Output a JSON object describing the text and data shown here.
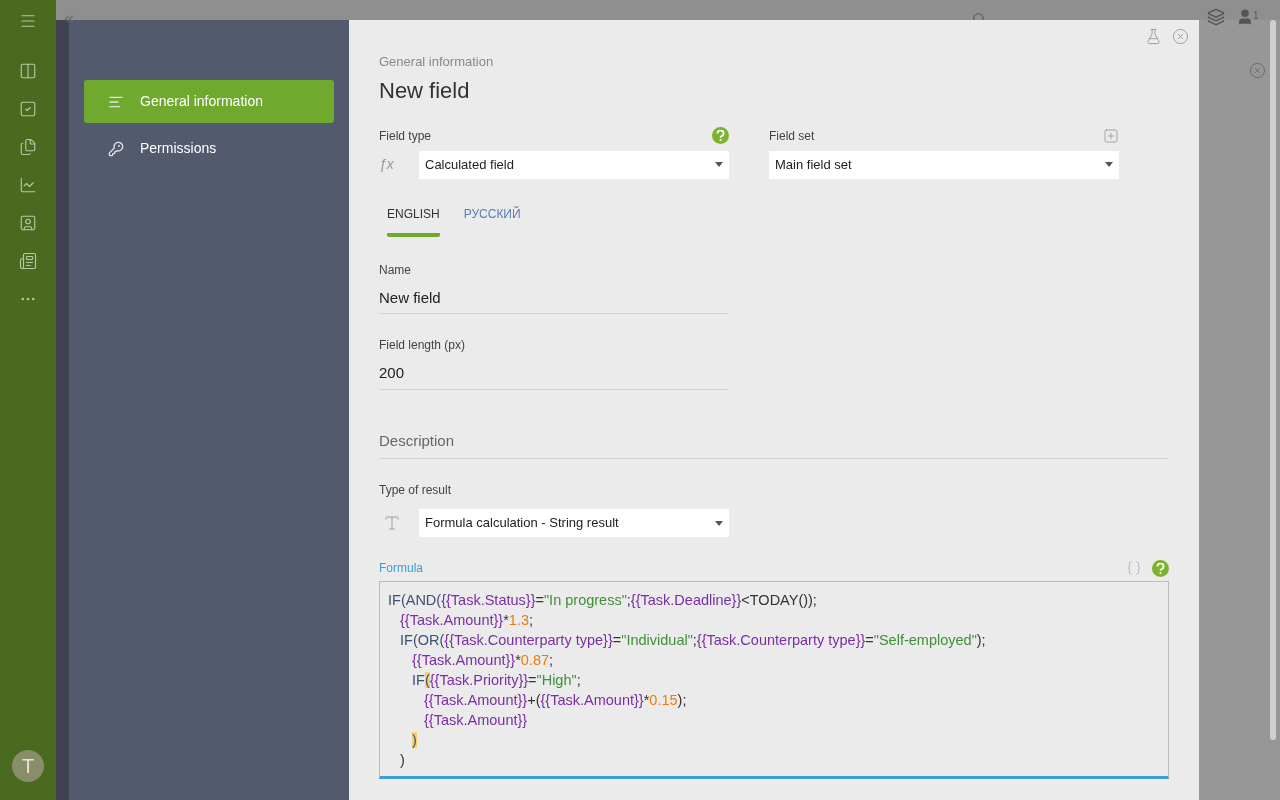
{
  "app_sidebar": {
    "items": [
      {
        "kind": "menu"
      },
      {
        "kind": "kanban"
      },
      {
        "kind": "tasks"
      },
      {
        "kind": "files"
      },
      {
        "kind": "reports"
      },
      {
        "kind": "contacts"
      },
      {
        "kind": "docs"
      },
      {
        "kind": "more"
      }
    ],
    "avatar": "T"
  },
  "top_bar": {
    "notification_count": "1"
  },
  "nav": [
    {
      "label": "General information",
      "selected": true,
      "kind": "general"
    },
    {
      "label": "Permissions",
      "selected": false,
      "kind": "permissions"
    }
  ],
  "header": {
    "breadcrumb": "General information",
    "title": "New field"
  },
  "field_type": {
    "label": "Field type",
    "symbol": "ƒx",
    "value": "Calculated field"
  },
  "field_set": {
    "label": "Field set",
    "value": "Main field set"
  },
  "language_tabs": [
    {
      "label": "ENGLISH",
      "selected": true
    },
    {
      "label": "РУССКИЙ",
      "selected": false
    }
  ],
  "name": {
    "label": "Name",
    "value": "New field"
  },
  "field_length": {
    "label": "Field length (px)",
    "value": "200"
  },
  "description": {
    "label": "Description"
  },
  "result_type": {
    "label": "Type of result",
    "value": "Formula calculation - String result"
  },
  "formula": {
    "label": "Formula",
    "lines": [
      {
        "tokens": [
          {
            "text": "IF(AND(",
            "kind": "keyword"
          },
          {
            "text": "{{Task.Status}}",
            "kind": "variable"
          },
          {
            "text": "=",
            "kind": "plain"
          },
          {
            "text": "\"In progress\"",
            "kind": "string"
          },
          {
            "text": ";",
            "kind": "plain"
          },
          {
            "text": "{{Task.Deadline}}",
            "kind": "variable"
          },
          {
            "text": "<TODAY());",
            "kind": "plain"
          }
        ],
        "children": [
          {
            "tokens": [
              {
                "text": "{{Task.Amount}}",
                "kind": "variable"
              },
              {
                "text": "*",
                "kind": "plain"
              },
              {
                "text": "1.3",
                "kind": "number"
              },
              {
                "text": ";",
                "kind": "plain"
              }
            ]
          },
          {
            "tokens": [
              {
                "text": "IF(OR(",
                "kind": "keyword"
              },
              {
                "text": "{{Task.Counterparty type}}",
                "kind": "variable"
              },
              {
                "text": "=",
                "kind": "plain"
              },
              {
                "text": "\"Individual\"",
                "kind": "string"
              },
              {
                "text": ";",
                "kind": "plain"
              },
              {
                "text": "{{Task.Counterparty type}}",
                "kind": "variable"
              },
              {
                "text": "=",
                "kind": "plain"
              },
              {
                "text": "\"Self-employed\"",
                "kind": "string"
              },
              {
                "text": ");",
                "kind": "plain"
              }
            ],
            "children": [
              {
                "tokens": [
                  {
                    "text": "{{Task.Amount}}",
                    "kind": "variable"
                  },
                  {
                    "text": "*",
                    "kind": "plain"
                  },
                  {
                    "text": "0.87",
                    "kind": "number"
                  },
                  {
                    "text": ";",
                    "kind": "plain"
                  }
                ]
              },
              {
                "tokens": [
                  {
                    "text": "IF",
                    "kind": "keyword"
                  },
                  {
                    "text": "(",
                    "kind": "bracket"
                  },
                  {
                    "text": "{{Task.Priority}}",
                    "kind": "variable"
                  },
                  {
                    "text": "=",
                    "kind": "plain"
                  },
                  {
                    "text": "\"High\"",
                    "kind": "string"
                  },
                  {
                    "text": ";",
                    "kind": "plain"
                  }
                ],
                "children": [
                  {
                    "tokens": [
                      {
                        "text": "{{Task.Amount}}",
                        "kind": "variable"
                      },
                      {
                        "text": "+(",
                        "kind": "plain"
                      },
                      {
                        "text": "{{Task.Amount}}",
                        "kind": "variable"
                      },
                      {
                        "text": "*",
                        "kind": "plain"
                      },
                      {
                        "text": "0.15",
                        "kind": "number"
                      },
                      {
                        "text": ");",
                        "kind": "plain"
                      }
                    ]
                  },
                  {
                    "tokens": [
                      {
                        "text": "{{Task.Amount}}",
                        "kind": "variable"
                      }
                    ]
                  }
                ]
              },
              {
                "tokens": [
                  {
                    "text": ")",
                    "kind": "bracket"
                  }
                ]
              }
            ]
          },
          {
            "tokens": [
              {
                "text": ")",
                "kind": "plain"
              }
            ]
          }
        ]
      }
    ]
  }
}
